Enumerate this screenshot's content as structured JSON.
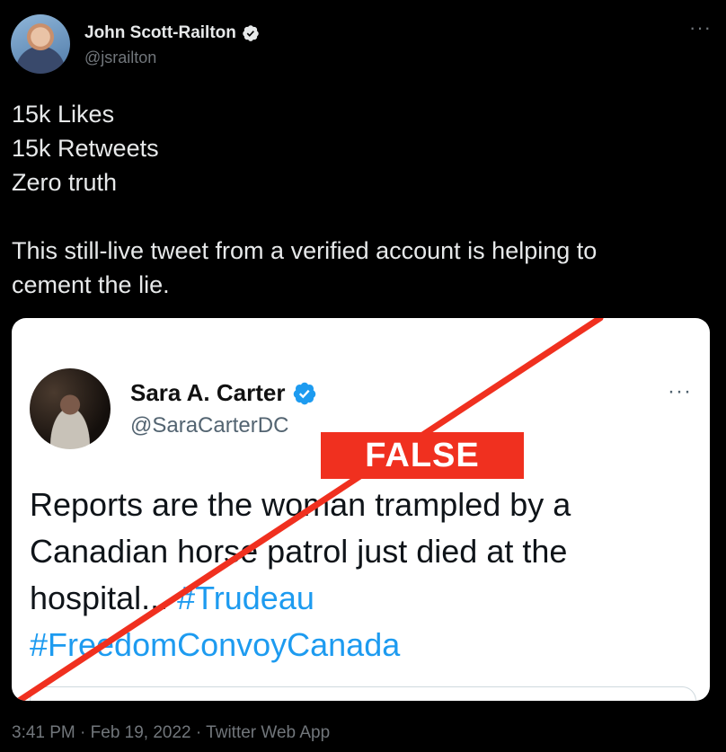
{
  "author": {
    "display_name": "John Scott-Railton",
    "handle": "@jsrailton",
    "verified_icon": "verified-badge-icon",
    "more_label": "···"
  },
  "tweet": {
    "lines": [
      "15k Likes",
      "15k Retweets",
      "Zero truth"
    ],
    "paragraph_line_1": "This still-live tweet from a verified account is helping to",
    "paragraph_line_2": "cement the lie."
  },
  "embedded_tweet": {
    "display_name": "Sara A. Carter",
    "handle": "@SaraCarterDC",
    "more_label": "···",
    "text_line_1": "Reports are the woman trampled by a",
    "text_line_2": "Canadian horse patrol just died at the",
    "text_line_3_plain": "hospital... ",
    "text_line_3_tag": "#Trudeau",
    "text_line_4_tag": "#FreedomConvoyCanada",
    "false_label": "FALSE",
    "strike_color": "#f0301f",
    "hashtag_color": "#1d9bf0"
  },
  "footer": {
    "meta": "3:41 PM · Feb 19, 2022 · Twitter Web App"
  },
  "colors": {
    "background": "#000000",
    "verified": "#1d9bf0"
  }
}
